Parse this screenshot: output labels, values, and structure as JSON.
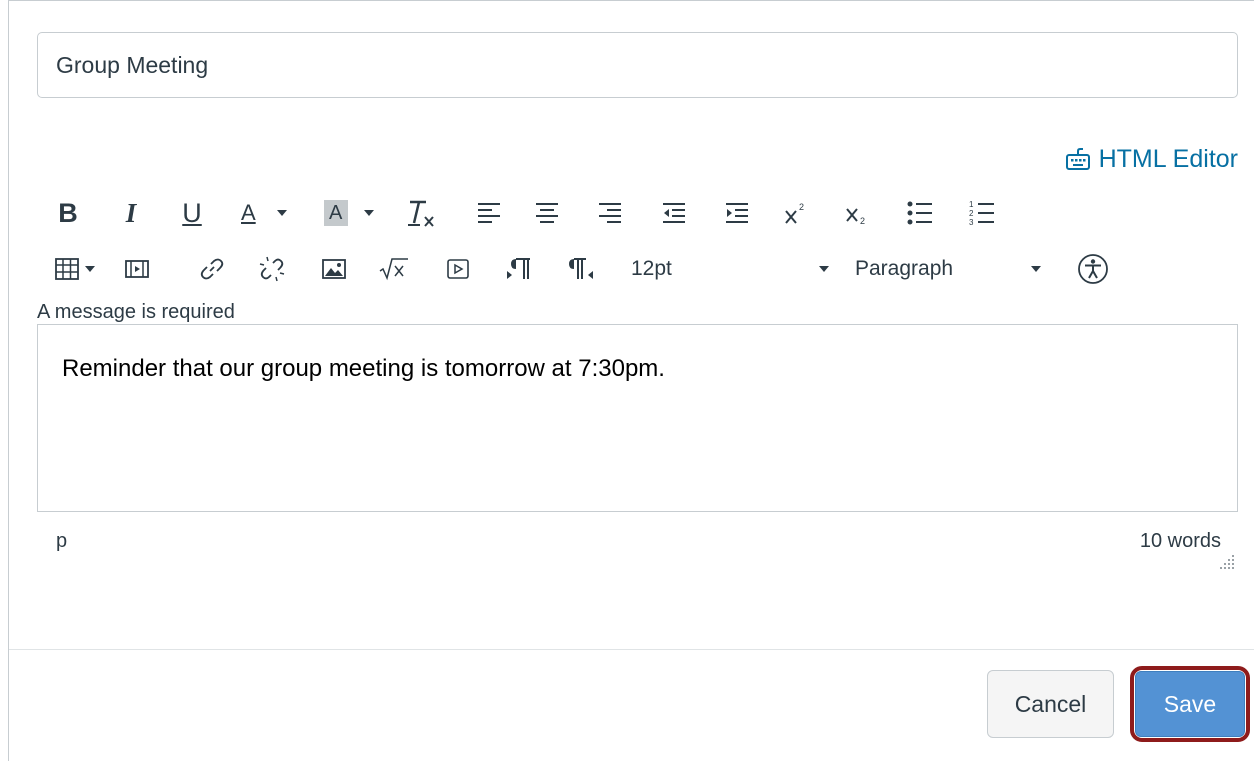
{
  "subject": {
    "value": "Group Meeting"
  },
  "html_editor": {
    "label": "HTML Editor",
    "icon": "keyboard-icon"
  },
  "toolbar": {
    "row1": [
      "bold",
      "italic",
      "underline",
      "text-color",
      "background-color",
      "clear-formatting",
      "align-left",
      "align-center",
      "align-right",
      "outdent",
      "indent",
      "superscript",
      "subscript",
      "bullet-list",
      "numbered-list"
    ],
    "row2": [
      "table",
      "media",
      "link",
      "unlink",
      "image",
      "math",
      "embed",
      "ltr",
      "rtl"
    ],
    "bold_glyph": "B",
    "italic_glyph": "I",
    "underline_glyph": "U",
    "text_color_glyph": "A",
    "bg_color_glyph": "A",
    "font_size": "12pt",
    "format": "Paragraph"
  },
  "validation": {
    "message": "A message is required"
  },
  "editor": {
    "content": "Reminder that our group meeting is tomorrow at 7:30pm."
  },
  "status": {
    "path": "p",
    "word_count": "10 words"
  },
  "buttons": {
    "cancel": "Cancel",
    "save": "Save"
  },
  "colors": {
    "link": "#0770a3",
    "save_bg": "#5392d4",
    "highlight": "#8e1b1b"
  }
}
